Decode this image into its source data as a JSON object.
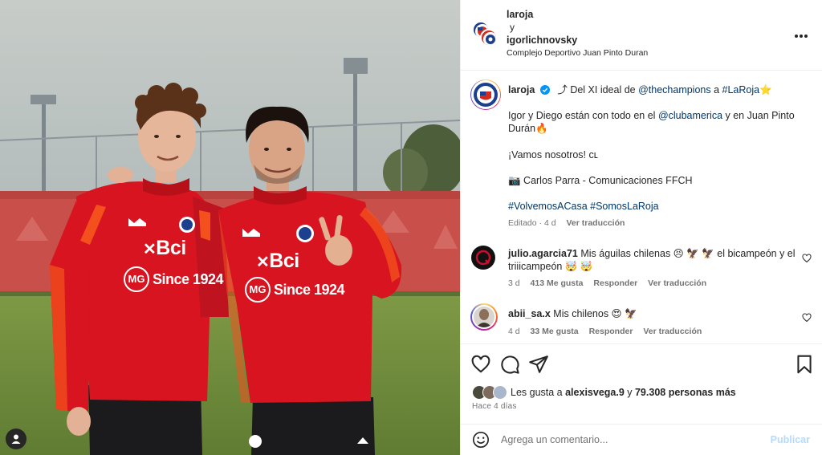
{
  "header": {
    "author1": "laroja",
    "connector": "y",
    "author2": "igorlichnovsky",
    "location": "Complejo Deportivo Juan Pinto Duran",
    "more_icon": "more-horizontal-icon"
  },
  "caption": {
    "username": "laroja",
    "verified_icon": "verified-badge-icon",
    "upload_emoji": "⤴",
    "line1_text": " Del XI ideal de ",
    "line1_mention": "@thechampions",
    "line1_mid": " a ",
    "line1_tag": "#LaRoja",
    "line1_emoji": "⭐",
    "line2_a": "Igor y Diego están con todo en el ",
    "line2_mention": "@clubamerica",
    "line2_b": " y en Juan Pinto",
    "line3": "Durán",
    "line3_emoji": "🔥",
    "line4": "¡Vamos nosotros! ᴄʟ",
    "line5": "📷 Carlos Parra - Comunicaciones FFCH",
    "hashtags": "#VolvemosACasa #SomosLaRoja",
    "edited": "Editado · 4 d",
    "see_translation": "Ver traducción"
  },
  "comments": [
    {
      "username": "julio.agarcia71",
      "text_a": " Mis águilas chilenas 😣 🦅 🦅 el bicampeón y el",
      "text_b": "triiicampeón 🤯 🤯",
      "time": "3 d",
      "likes": "413 Me gusta",
      "reply": "Responder",
      "translate": "Ver traducción"
    },
    {
      "username": "abii_sa.x",
      "text_a": " Mis chilenos 😍 🦅",
      "time": "4 d",
      "likes": "33 Me gusta",
      "reply": "Responder",
      "translate": "Ver traducción"
    }
  ],
  "likes": {
    "prefix": "Les gusta a ",
    "user": "alexisvega.9",
    "middle": " y ",
    "count": "79.308 personas más"
  },
  "time_ago": "Hace 4 días",
  "add_comment": {
    "placeholder": "Agrega un comentario...",
    "publish": "Publicar"
  },
  "image_text": {
    "sponsor": "Bci",
    "sponsor_mark": "✕",
    "mg_logo": "MG",
    "since": "Since 1924"
  },
  "colors": {
    "jersey_red": "#d7141f",
    "jersey_orange": "#f3501e",
    "link": "#00376b",
    "publish": "#b3dbff"
  }
}
